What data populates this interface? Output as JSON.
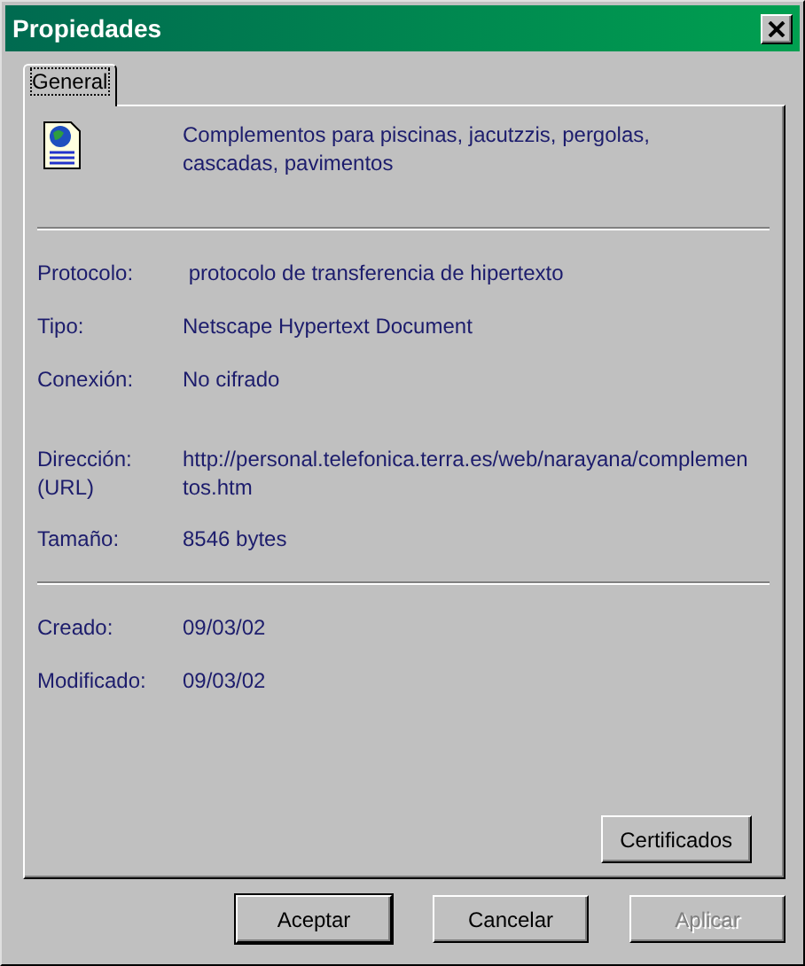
{
  "window": {
    "title": "Propiedades"
  },
  "tabs": [
    {
      "label": "General",
      "selected": true
    }
  ],
  "description": "Complementos para piscinas, jacutzzis, pergolas, cascadas, pavimentos",
  "sections": [
    {
      "rows": [
        {
          "label": "Protocolo:",
          "value": " protocolo de transferencia de hipertexto"
        },
        {
          "label": "Tipo:",
          "value": "Netscape Hypertext Document"
        },
        {
          "label": "Conexión:",
          "value": "No cifrado"
        },
        {
          "label": "Dirección: (URL)",
          "value": "http://personal.telefonica.terra.es/web/narayana/complementos.htm"
        },
        {
          "label": "Tamaño:",
          "value": "8546 bytes"
        }
      ]
    },
    {
      "rows": [
        {
          "label": "Creado:",
          "value": "09/03/02"
        },
        {
          "label": "Modificado:",
          "value": "09/03/02"
        }
      ]
    }
  ],
  "certificates_button": {
    "label": "Certificados",
    "disabled": false
  },
  "buttons": [
    {
      "label": "Aceptar",
      "default": true,
      "disabled": false
    },
    {
      "label": "Cancelar",
      "default": false,
      "disabled": false
    },
    {
      "label": "Aplicar",
      "default": false,
      "disabled": true
    }
  ]
}
